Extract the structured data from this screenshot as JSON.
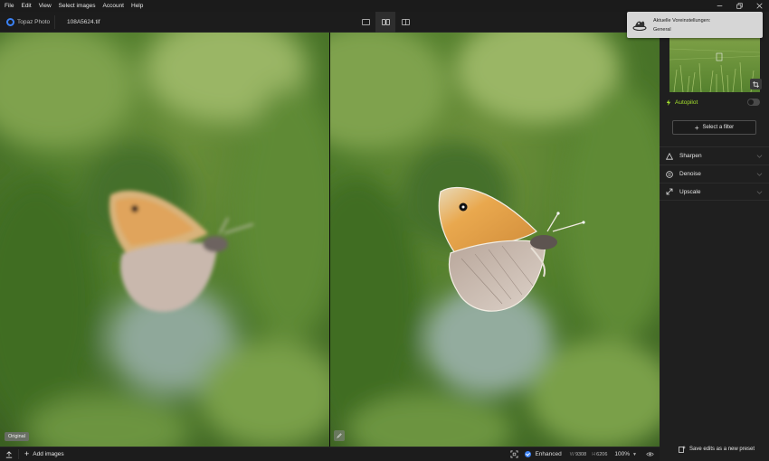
{
  "menu": {
    "items": [
      "File",
      "Edit",
      "View",
      "Select images",
      "Account",
      "Help"
    ]
  },
  "toolbar": {
    "app_name": "Topaz Photo",
    "filename": "108A5624.tif"
  },
  "left_pane": {
    "label": "Original"
  },
  "bottom": {
    "add_images": "Add images",
    "enhanced_label": "Enhanced",
    "width_label": "W",
    "width": "9308",
    "height_label": "H",
    "height": "6206",
    "zoom": "100%"
  },
  "toast": {
    "title": "Aktuelle Voreinstellungen:",
    "subtitle": "General"
  },
  "panel": {
    "autopilot_label": "Autopilot",
    "select_filter": "Select a filter",
    "filters": [
      "Sharpen",
      "Denoise",
      "Upscale"
    ],
    "save_preset": "Save edits as a new preset"
  },
  "colors": {
    "accent_blue": "#3b82f6",
    "autopilot_green": "#a6e22e",
    "background": "#141414"
  }
}
